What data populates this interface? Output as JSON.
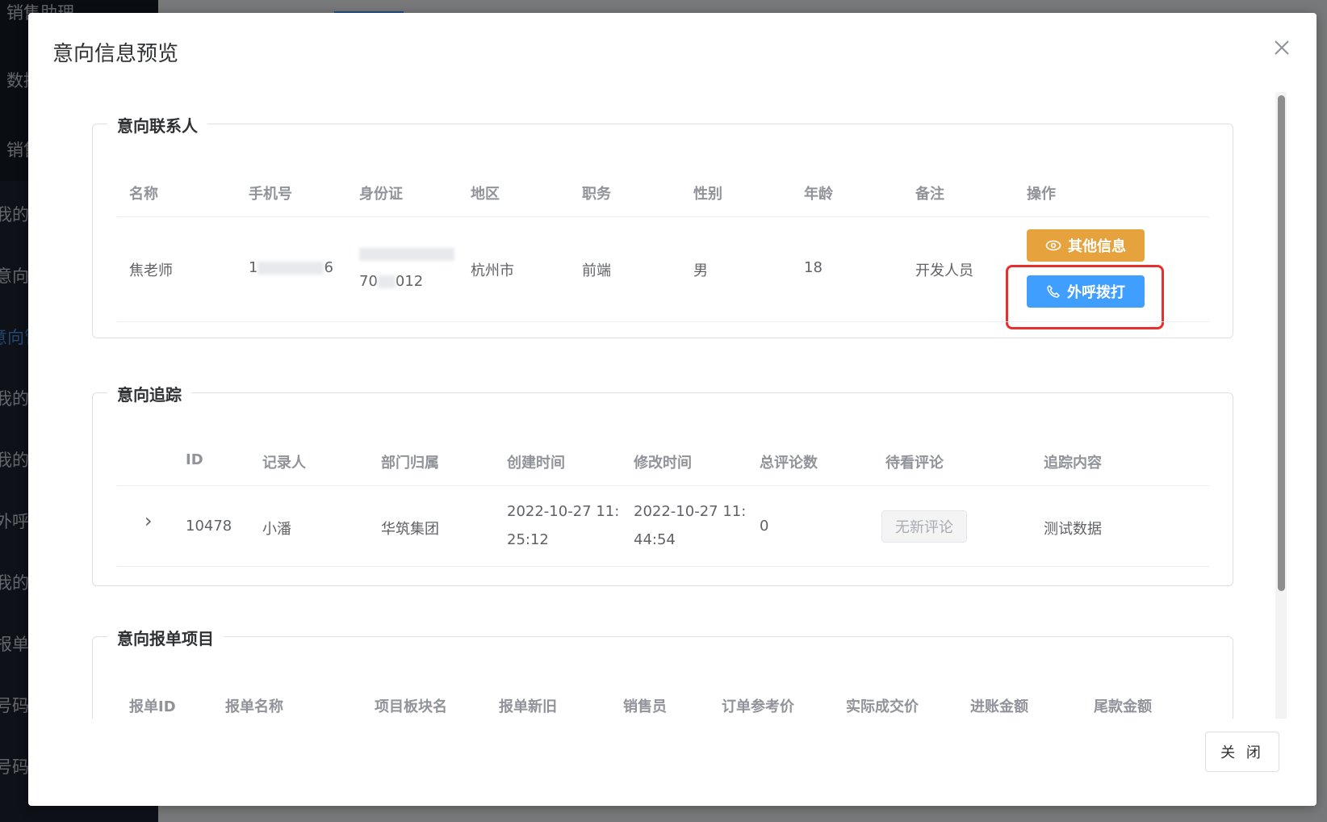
{
  "background": {
    "sidebar_items": [
      "销售助理",
      "数据",
      "销售",
      "我的",
      "意向",
      "意向管",
      "我的",
      "我的客",
      "外呼",
      "我的发",
      "报单",
      "号码",
      "号码"
    ]
  },
  "dialog": {
    "title": "意向信息预览",
    "close_button": "关 闭",
    "close_icon": "close-icon"
  },
  "contacts": {
    "legend": "意向联系人",
    "columns": [
      "名称",
      "手机号",
      "身份证",
      "地区",
      "职务",
      "性别",
      "年龄",
      "备注",
      "操作"
    ],
    "rows": [
      {
        "name": "焦老师",
        "phone_prefix": "1",
        "phone_suffix": "6",
        "id_line1": "",
        "id_line2_prefix": "70",
        "id_line2_suffix": "012",
        "region": "杭州市",
        "position": "前端",
        "gender": "男",
        "age": "18",
        "remark": "开发人员",
        "actions": {
          "other_info": "其他信息",
          "call": "外呼拨打"
        }
      }
    ]
  },
  "tracking": {
    "legend": "意向追踪",
    "columns": [
      "ID",
      "记录人",
      "部门归属",
      "创建时间",
      "修改时间",
      "总评论数",
      "待看评论",
      "追踪内容"
    ],
    "rows": [
      {
        "id": "10478",
        "recorder": "小潘",
        "department": "华筑集团",
        "created_line1": "2022-10-27 11:",
        "created_line2": "25:12",
        "modified_line1": "2022-10-27 11:",
        "modified_line2": "44:54",
        "total_comments": "0",
        "pending_comment": "无新评论",
        "content": "测试数据"
      }
    ]
  },
  "orders": {
    "legend": "意向报单项目",
    "columns": [
      "报单ID",
      "报单名称",
      "项目板块名",
      "报单新旧",
      "销售员",
      "订单参考价",
      "实际成交价",
      "进账金额",
      "尾款金额"
    ]
  },
  "colors": {
    "warning": "#e6a23c",
    "primary": "#409eff",
    "highlight": "#e6302b"
  }
}
